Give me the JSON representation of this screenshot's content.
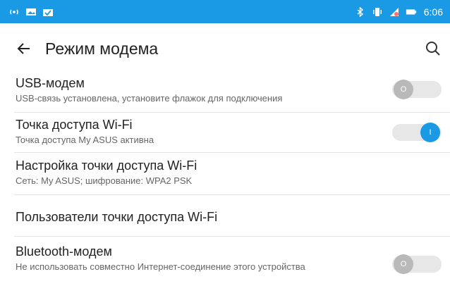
{
  "status_bar": {
    "time": "6:06",
    "left_icons": [
      "hotspot-icon",
      "image-icon",
      "task-icon"
    ],
    "right_icons": [
      "bluetooth-icon",
      "vibrate-icon",
      "no-sim-icon",
      "battery-icon"
    ],
    "background": "#1a9ae4"
  },
  "header": {
    "title": "Режим модема"
  },
  "items": [
    {
      "title": "USB-модем",
      "subtitle": "USB-связь установлена, установите флажок для подключения",
      "toggle_state": "off",
      "toggle_glyph": "O"
    },
    {
      "title": "Точка доступа Wi-Fi",
      "subtitle": "Точка доступа My ASUS активна",
      "toggle_state": "on",
      "toggle_glyph": "I"
    },
    {
      "title": "Настройка точки доступа Wi-Fi",
      "subtitle": "Сеть: My ASUS; шифрование: WPA2 PSK"
    },
    {
      "title": "Пользователи точки доступа Wi-Fi"
    },
    {
      "title": "Bluetooth-модем",
      "subtitle": "Не использовать совместно Интернет-соединение этого устройства",
      "toggle_state": "off",
      "toggle_glyph": "O"
    }
  ],
  "colors": {
    "accent": "#1a9ae4",
    "toggle_off_knob": "#b9b9b9",
    "toggle_track": "#e7e7e7"
  }
}
